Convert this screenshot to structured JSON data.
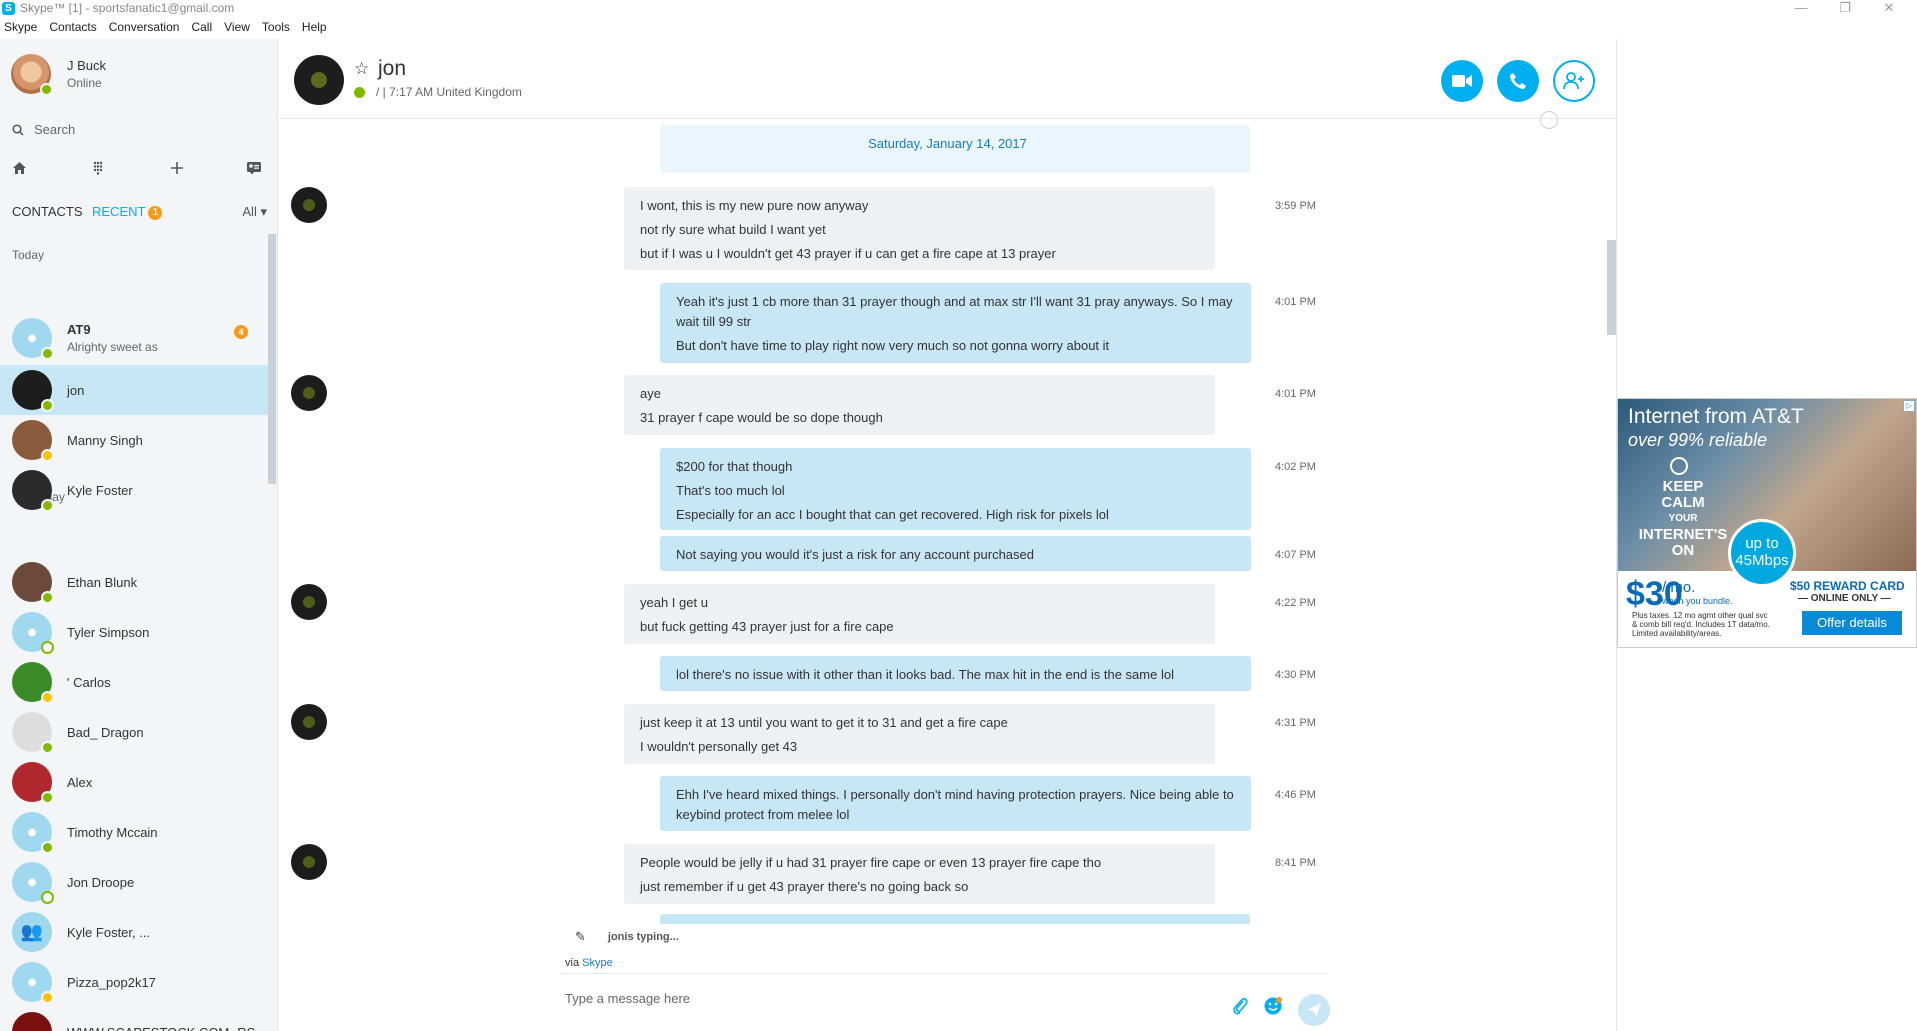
{
  "window": {
    "title": "Skype™ [1] - sportsfanatic1@gmail.com",
    "logo": "S"
  },
  "menu": [
    "Skype",
    "Contacts",
    "Conversation",
    "Call",
    "View",
    "Tools",
    "Help"
  ],
  "profile": {
    "name": "J Buck",
    "status": "Online"
  },
  "search": {
    "placeholder": "Search"
  },
  "tabs": {
    "contacts": "CONTACTS",
    "recent": "RECENT",
    "recent_badge": "1",
    "filter": "All"
  },
  "sections": {
    "today": "Today",
    "yesterday": "Yesterday"
  },
  "contacts": [
    {
      "name": "AT9",
      "sub": "Alrighty sweet as",
      "badge": "4",
      "status": "online"
    },
    {
      "name": "jon",
      "sub": "",
      "status": "online",
      "selected": true
    },
    {
      "name": "Manny Singh",
      "sub": "",
      "status": "away"
    },
    {
      "name": "Kyle Foster",
      "sub": "",
      "status": "online"
    },
    {
      "name": "Ethan Blunk",
      "sub": "",
      "status": "online"
    },
    {
      "name": "Tyler Simpson",
      "sub": "",
      "status": "offline"
    },
    {
      "name": "' Carlos",
      "sub": "",
      "status": "away"
    },
    {
      "name": "Bad_ Dragon",
      "sub": "",
      "status": "online"
    },
    {
      "name": "Alex",
      "sub": "",
      "status": "online"
    },
    {
      "name": "Timothy Mccain",
      "sub": "",
      "status": "online"
    },
    {
      "name": "Jon Droope",
      "sub": "",
      "status": "offline"
    },
    {
      "name": "Kyle Foster, ...",
      "sub": "",
      "status": "group"
    },
    {
      "name": "Pizza_pop2k17",
      "sub": "",
      "status": "away"
    },
    {
      "name": "WWW.SCAPESTOCK.COM -RS...",
      "sub": "",
      "status": "offline"
    }
  ],
  "chat": {
    "name": "jon",
    "meta": "/  |  7:17 AM United Kingdom",
    "date": "Saturday, January 14, 2017"
  },
  "messages": [
    {
      "dir": "in",
      "time": "3:59 PM",
      "lines": [
        "I wont, this is my new pure now anyway",
        "not rly sure what build I want yet",
        "but if I was u I wouldn't get 43 prayer if u can get a fire cape at 13 prayer"
      ]
    },
    {
      "dir": "out",
      "time": "4:01 PM",
      "lines": [
        "Yeah it's just 1 cb more than 31 prayer though and at max str I'll want 31 pray anyways. So I may wait till 99 str",
        "But don't have time to play right now very much so not gonna worry about it"
      ]
    },
    {
      "dir": "in",
      "time": "4:01 PM",
      "lines": [
        "aye",
        "31 prayer f cape would be so dope though"
      ]
    },
    {
      "dir": "out",
      "time": "4:02 PM",
      "lines": [
        "$200 for that though",
        "That's too much lol",
        "Especially for an acc I bought that can get recovered. High risk for pixels lol"
      ]
    },
    {
      "dir": "out",
      "time": "4:07 PM",
      "lines": [
        "Not saying you would it's just a risk for any account purchased"
      ]
    },
    {
      "dir": "in",
      "time": "4:22 PM",
      "lines": [
        "yeah I get u",
        "but fuck getting 43 prayer just for a fire cape"
      ]
    },
    {
      "dir": "out",
      "time": "4:30 PM",
      "lines": [
        "lol there's no issue with it other than it looks bad. The max hit in the end is the same lol"
      ]
    },
    {
      "dir": "in",
      "time": "4:31 PM",
      "lines": [
        "just keep it at 13 until you want to get it to 31 and get a fire cape",
        "I wouldn't personally get 43"
      ]
    },
    {
      "dir": "out",
      "time": "4:46 PM",
      "lines": [
        "Ehh I've heard mixed things. I personally don't mind having protection prayers. Nice being able to keybind protect from melee lol"
      ]
    },
    {
      "dir": "in",
      "time": "8:41 PM",
      "lines": [
        "People would be jelly if u had 31 prayer fire cape or even 13 prayer fire cape tho",
        "just remember if u get 43 prayer there's no going back so"
      ]
    }
  ],
  "typing": {
    "who": "jon",
    "text": " is typing..."
  },
  "via": {
    "prefix": "via ",
    "link": "Skype"
  },
  "composer": {
    "placeholder": "Type a message here"
  },
  "ad": {
    "headline": "Internet from AT&T",
    "subhead": "over 99% reliable",
    "keep_calm": [
      "KEEP",
      "CALM",
      "YOUR",
      "INTERNET'S",
      "ON"
    ],
    "speed_top": "up to",
    "speed_value": "45Mbps",
    "price": "$30",
    "per_month": "/ mo.",
    "bundle": "when you bundle.",
    "fine_print": "Plus taxes. 12 mo agmt other qual svc & comb bill req'd. Includes 1T data/mo. Limited availability/areas.",
    "reward": "$50 REWARD CARD",
    "online_only": "— ONLINE ONLY —",
    "cta": "Offer details",
    "adchoices": "▷"
  },
  "colors": {
    "accent": "#00aff0",
    "bubble_out": "#c7e6f6",
    "bubble_in": "#eef1f4",
    "online": "#7fba00",
    "away": "#fdc300",
    "badge": "#f8981d"
  }
}
